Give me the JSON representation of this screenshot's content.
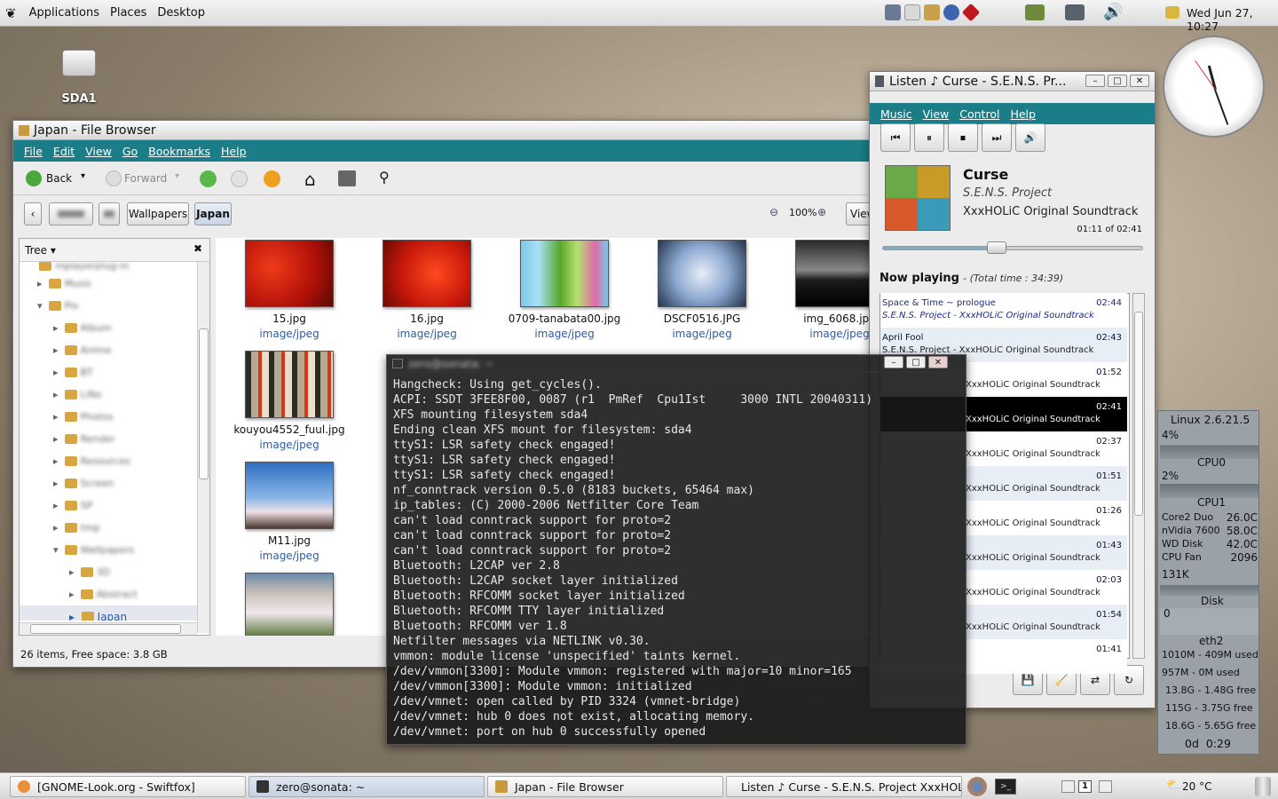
{
  "top_panel": {
    "menus": [
      "Applications",
      "Places",
      "Desktop"
    ],
    "clock": "Wed Jun 27, 10:27"
  },
  "desktop": {
    "icon_label": "SDA1"
  },
  "file_browser": {
    "title": "Japan - File Browser",
    "menus": [
      "File",
      "Edit",
      "View",
      "Go",
      "Bookmarks",
      "Help"
    ],
    "toolbar": {
      "back": "Back",
      "forward": "Forward"
    },
    "path": {
      "wallpapers": "Wallpapers",
      "japan": "Japan"
    },
    "zoom": "100%",
    "view_label": "View",
    "side_pane_label": "Tree",
    "tree_top_item": "mplayerplug-in",
    "tree_selected": "Japan",
    "items": [
      {
        "name": "15.jpg",
        "type": "image/jpeg"
      },
      {
        "name": "16.jpg",
        "type": "image/jpeg"
      },
      {
        "name": "0709-tanabata00.jpg",
        "type": "image/jpeg"
      },
      {
        "name": "DSCF0516.JPG",
        "type": "image/jpeg"
      },
      {
        "name": "img_6068.jpg",
        "type": "image/jpeg"
      },
      {
        "name": "kouyou4552_fuul.jpg",
        "type": "image/jpeg"
      },
      {
        "name": "M11.jpg",
        "type": "image/jpeg"
      }
    ],
    "status": "26 items, Free space: 3.8 GB"
  },
  "terminal": {
    "lines": [
      "Hangcheck: Using get_cycles().",
      "ACPI: SSDT 3FEE8F00, 0087 (r1  PmRef  Cpu1Ist     3000 INTL 20040311)",
      "XFS mounting filesystem sda4",
      "Ending clean XFS mount for filesystem: sda4",
      "ttyS1: LSR safety check engaged!",
      "ttyS1: LSR safety check engaged!",
      "ttyS1: LSR safety check engaged!",
      "nf_conntrack version 0.5.0 (8183 buckets, 65464 max)",
      "ip_tables: (C) 2000-2006 Netfilter Core Team",
      "can't load conntrack support for proto=2",
      "can't load conntrack support for proto=2",
      "can't load conntrack support for proto=2",
      "Bluetooth: L2CAP ver 2.8",
      "Bluetooth: L2CAP socket layer initialized",
      "Bluetooth: RFCOMM socket layer initialized",
      "Bluetooth: RFCOMM TTY layer initialized",
      "Bluetooth: RFCOMM ver 1.8",
      "Netfilter messages via NETLINK v0.30.",
      "vmmon: module license 'unspecified' taints kernel.",
      "/dev/vmmon[3300]: Module vmmon: registered with major=10 minor=165",
      "/dev/vmmon[3300]: Module vmmon: initialized",
      "/dev/vmnet: open called by PID 3324 (vmnet-bridge)",
      "/dev/vmnet: hub 0 does not exist, allocating memory.",
      "/dev/vmnet: port on hub 0 successfully opened"
    ]
  },
  "player": {
    "title": "Listen ♪ Curse  - S.E.N.S. Pr...",
    "menus": [
      "Music",
      "View",
      "Control",
      "Help"
    ],
    "track": "Curse",
    "artist": "S.E.N.S. Project",
    "album": "XxxHOLiC Original Soundtrack",
    "position": "01:11 of 02:41",
    "progress_fraction": 0.44,
    "now_playing_label": "Now playing",
    "total_time": "- (Total time : 34:39)",
    "playlist": [
      {
        "title": "Space & Time ~ prologue",
        "sub": "S.E.N.S. Project - XxxHOLiC Original Soundtrack",
        "time": "02:44"
      },
      {
        "title": "April Fool",
        "sub": "S.E.N.S. Project - XxxHOLiC Original Soundtrack",
        "time": "02:43"
      },
      {
        "title": "",
        "sub": "XxxHOLiC Original Soundtrack",
        "time": "01:52"
      },
      {
        "title": "",
        "sub": "XxxHOLiC Original Soundtrack",
        "time": "02:41"
      },
      {
        "title": "",
        "sub": "XxxHOLiC Original Soundtrack",
        "time": "02:37"
      },
      {
        "title": "",
        "sub": "XxxHOLiC Original Soundtrack",
        "time": "01:51"
      },
      {
        "title": "",
        "sub": "XxxHOLiC Original Soundtrack",
        "time": "01:26"
      },
      {
        "title": "",
        "sub": "XxxHOLiC Original Soundtrack",
        "time": "01:43"
      },
      {
        "title": "",
        "sub": "XxxHOLiC Original Soundtrack",
        "time": "02:03"
      },
      {
        "title": "",
        "sub": "XxxHOLiC Original Soundtrack",
        "time": "01:54"
      },
      {
        "title": "",
        "sub": "",
        "time": "01:41"
      }
    ]
  },
  "sysmon": {
    "kernel": "Linux 2.6.21.5",
    "cpu0_pct": "4%",
    "cpu0_label": "CPU0",
    "cpu1_pct": "2%",
    "cpu1_label": "CPU1",
    "temps": [
      {
        "label": "Core2 Duo",
        "value": "26.0C"
      },
      {
        "label": "nVidia 7600",
        "value": "58.0C"
      },
      {
        "label": "WD Disk",
        "value": "42.0C"
      },
      {
        "label": "CPU Fan",
        "value": "2096"
      }
    ],
    "disk_rate": "131K",
    "disk_label": "Disk",
    "net_rate": "0",
    "net_label": "eth2",
    "mem": "1010M - 409M used",
    "swap": "957M - 0M used",
    "fs": [
      "13.8G - 1.48G free",
      "115G - 3.75G free",
      "18.6G - 5.65G free"
    ],
    "uptime": "0d  0:29"
  },
  "taskbar": {
    "tasks": [
      "[GNOME-Look.org - Swiftfox]",
      "zero@sonata: ~",
      "Japan - File Browser",
      "Listen ♪ Curse  - S.E.N.S. Project XxxHOLiC..."
    ],
    "workspace": "1",
    "weather": "20 °C"
  }
}
